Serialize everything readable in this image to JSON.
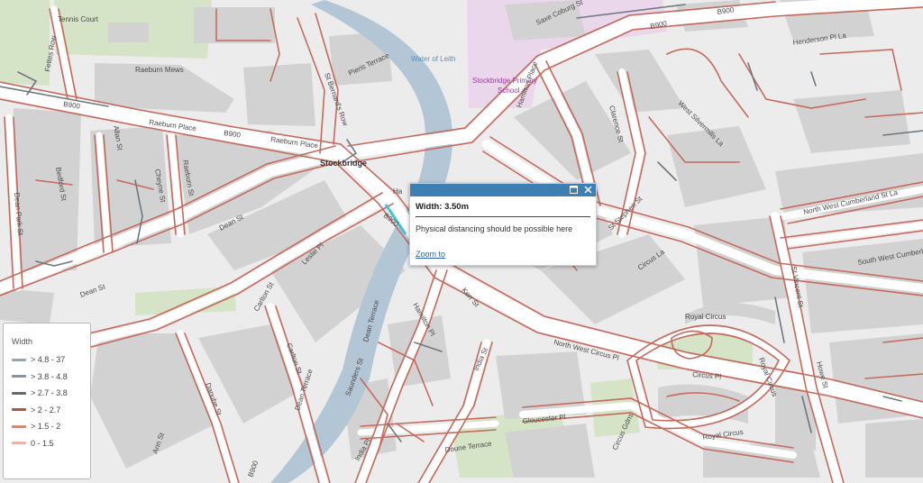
{
  "map": {
    "colors": {
      "background": "#ececec",
      "block": "#d1d1d1",
      "street": "#ffffff",
      "edge": "#c56a5c",
      "edge_dark": "#6e7780",
      "water": "#b3c6d6",
      "park": "#d5e3c7",
      "school": "#ead7ec",
      "highlight": "#3fc3d8"
    },
    "labels": {
      "tennis_court": "Tennis Court",
      "fettes_row": "Fettes Row",
      "raeburn_mews": "Raeburn Mews",
      "b900_1": "B900",
      "raeburn_place_1": "Raeburn Place",
      "b900_2": "B900",
      "raeburn_place_2": "Raeburn Place",
      "stockbridge": "Stockbridge",
      "st_bernards_row": "St Bernard's Row",
      "pieris_terrace": "Pieris Terrace",
      "water_of_leith": "Water of Leith",
      "school": "Stockbridge Primary",
      "school_2": "School",
      "saxe_coburg": "Saxe Coburg St",
      "b900_3": "B900",
      "b900_4": "B900",
      "henderson": "Henderson Pl La",
      "hamilton": "Hamilton Place",
      "clarence": "Clarence St",
      "west_silvermills": "West Silvermills La",
      "dean_park": "Dean Park St",
      "bedford": "Bedford St",
      "allan": "Allan St",
      "cheyne": "Cheyne St",
      "raeburn_st": "Raeburn St",
      "dean_st": "Dean St",
      "dean_st_2": "Dean St",
      "leslie": "Leslie Pl",
      "b900_5": "B900",
      "st_stephen": "St Stephen St",
      "circus_la": "Circus La",
      "nw_cumberland": "North West Cumberland St La",
      "st_vincent": "St Vincent St",
      "sw_cumberland": "South West Cumberland St La",
      "royal_circus_1": "Royal Circus",
      "royal_circus_2": "Royal Circus",
      "royal_circus_3": "Royal Circus",
      "dean_terrace_1": "Dean Terrace",
      "dean_terrace_2": "Dean Terrace",
      "carlton_1": "Carlton St",
      "carlton_2": "Carlton St",
      "danube": "Danube St",
      "saunders": "Saunders St",
      "kerr": "Kerr St",
      "india": "India St",
      "india_pl": "India Pl",
      "nw_circus": "North West Circus Pl",
      "circus_pl": "Circus Pl",
      "howe": "Howe St",
      "gloucester": "Gloucester Pl",
      "circus_gdns": "Circus Gdns",
      "doune": "Doune Terrace",
      "ann": "Ann St",
      "hamilton_2": "Hamilton Pl",
      "hm": "Ha",
      "b900_6": "B900"
    }
  },
  "popup": {
    "title": "Width: 3.50m",
    "description": "Physical distancing should be possible here",
    "link": "Zoom to",
    "maximize_icon": "maximize-icon",
    "close_icon": "close-icon"
  },
  "legend": {
    "title": "Width",
    "items": [
      {
        "label": "> 4.8 - 37",
        "color": "#9aa3ac"
      },
      {
        "label": "> 3.8 - 4.8",
        "color": "#8a939d"
      },
      {
        "label": "> 2.7 - 3.8",
        "color": "#5f6a75"
      },
      {
        "label": "> 2 - 2.7",
        "color": "#b2543f"
      },
      {
        "label": "> 1.5 - 2",
        "color": "#d18a7a"
      },
      {
        "label": "0 - 1.5",
        "color": "#e9b5a9"
      }
    ]
  }
}
